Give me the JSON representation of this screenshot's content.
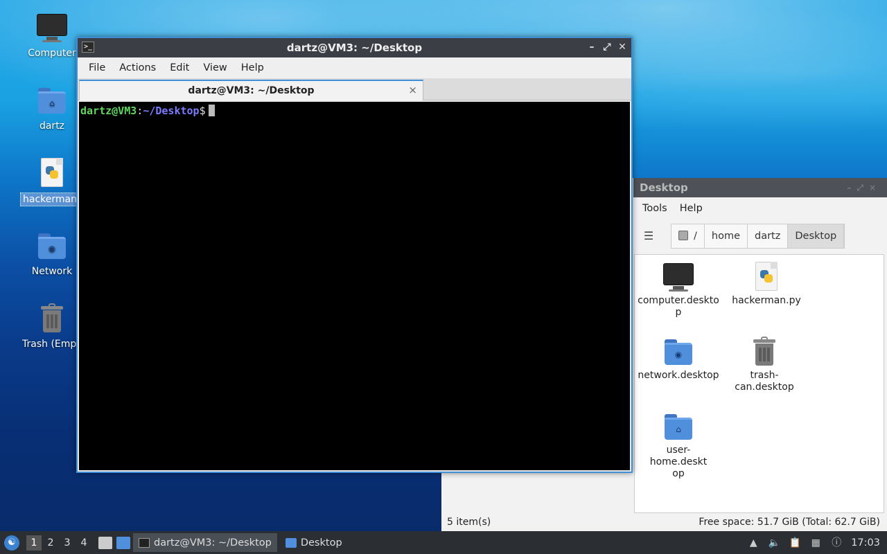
{
  "desktop": {
    "icons": [
      {
        "label": "Computer",
        "icon": "computer-icon"
      },
      {
        "label": "dartz",
        "icon": "home-folder-icon"
      },
      {
        "label": "hackerman.py",
        "icon": "python-file-icon"
      },
      {
        "label": "Network",
        "icon": "network-folder-icon"
      },
      {
        "label": "Trash (Empty)",
        "icon": "trash-icon"
      }
    ]
  },
  "terminal": {
    "title": "dartz@VM3: ~/Desktop",
    "menu": [
      "File",
      "Actions",
      "Edit",
      "View",
      "Help"
    ],
    "tab_label": "dartz@VM3: ~/Desktop",
    "tab_close": "×",
    "prompt_user": "dartz@VM3",
    "prompt_sep": ":",
    "prompt_path": "~/Desktop",
    "prompt_sym": "$",
    "colors": {
      "user": "#5fd75f",
      "path": "#7b7bff",
      "accent": "#3f8ed8"
    }
  },
  "file_manager": {
    "title": "Desktop",
    "menu": [
      "Tools",
      "Help"
    ],
    "breadcrumbs": [
      "/",
      "home",
      "dartz",
      "Desktop"
    ],
    "items": [
      {
        "label": "computer.desktop",
        "icon": "computer-icon"
      },
      {
        "label": "hackerman.py",
        "icon": "python-file-icon"
      },
      {
        "label": "network.desktop",
        "icon": "network-folder-icon"
      },
      {
        "label": "trash-can.desktop",
        "icon": "trash-icon"
      },
      {
        "label": "user-home.desktop",
        "icon": "home-folder-icon"
      }
    ],
    "status_items": "5 item(s)",
    "status_space": "Free space: 51.7 GiB (Total: 62.7 GiB)"
  },
  "taskbar": {
    "workspaces": [
      "1",
      "2",
      "3",
      "4"
    ],
    "tasks": [
      {
        "label": "dartz@VM3: ~/Desktop",
        "icon": "terminal-icon"
      },
      {
        "label": "Desktop",
        "icon": "folder-icon"
      }
    ],
    "clock": "17:03"
  }
}
